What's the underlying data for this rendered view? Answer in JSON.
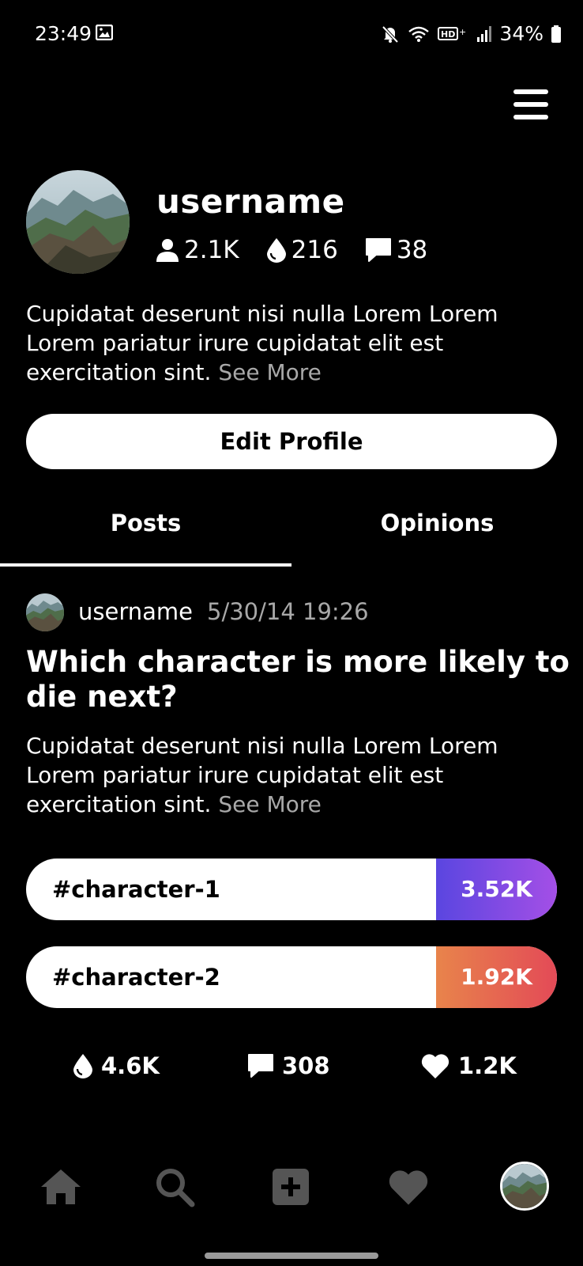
{
  "status_bar": {
    "time": "23:49",
    "battery": "34%",
    "icons": [
      "gallery-icon",
      "mute-icon",
      "wifi-icon",
      "hd-plus-icon",
      "signal-icon",
      "battery-icon"
    ]
  },
  "profile": {
    "username": "username",
    "followers": "2.1K",
    "drops": "216",
    "comments": "38",
    "bio": "Cupidatat deserunt nisi nulla Lorem Lorem Lorem pariatur irure cupidatat elit est exercitation sint.",
    "see_more": "See More",
    "edit_button": "Edit Profile"
  },
  "tabs": [
    {
      "label": "Posts",
      "active": true
    },
    {
      "label": "Opinions",
      "active": false
    }
  ],
  "post": {
    "username": "username",
    "date": "5/30/14 19:26",
    "title": "Which character is more likely to die next?",
    "body": "Cupidatat deserunt nisi nulla Lorem Lorem Lorem pariatur irure cupidatat elit est exercitation sint.",
    "see_more": "See More",
    "options": [
      {
        "label": "#character-1",
        "count": "3.52K",
        "color_start": "#5a46e0",
        "color_end": "#a44fe6"
      },
      {
        "label": "#character-2",
        "count": "1.92K",
        "color_start": "#e8844b",
        "color_end": "#e34a57"
      }
    ],
    "actions": {
      "drops": "4.6K",
      "comments": "308",
      "likes": "1.2K"
    }
  },
  "bottom_nav": {
    "items": [
      "home-icon",
      "search-icon",
      "add-icon",
      "heart-icon",
      "profile-avatar"
    ],
    "inactive_color": "#555555"
  }
}
